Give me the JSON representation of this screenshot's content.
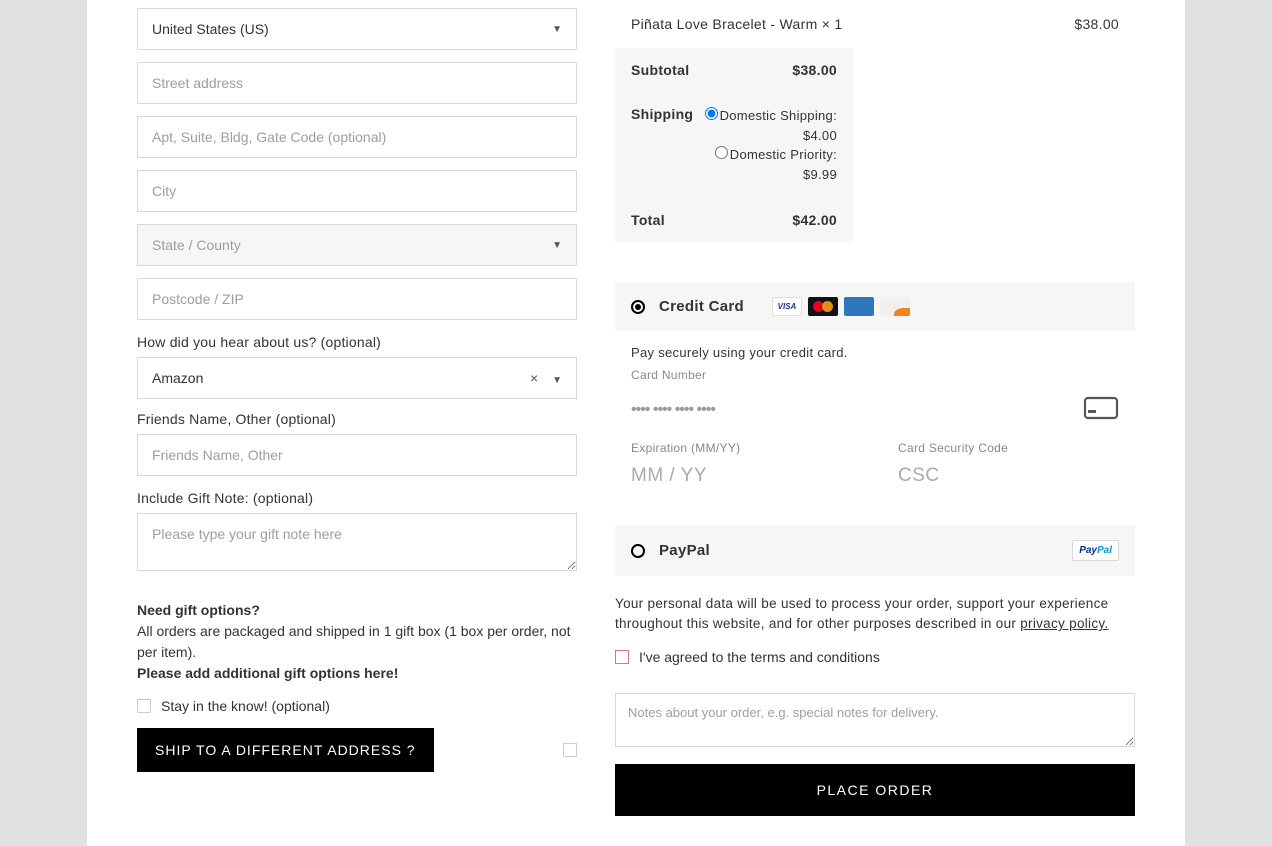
{
  "billing": {
    "country_value": "United States (US)",
    "street_placeholder": "Street address",
    "apt_placeholder": "Apt, Suite, Bldg, Gate Code (optional)",
    "city_placeholder": "City",
    "state_placeholder": "State / County",
    "zip_placeholder": "Postcode / ZIP"
  },
  "referral": {
    "label": "How did you hear about us? (optional)",
    "value": "Amazon"
  },
  "friends": {
    "label": "Friends Name, Other (optional)",
    "placeholder": "Friends Name, Other"
  },
  "gift_note": {
    "label": "Include Gift Note: (optional)",
    "placeholder": "Please type your gift note here"
  },
  "gift_info": {
    "heading": "Need gift options?",
    "line": "All orders are packaged and shipped in 1 gift box (1 box per order, not per item).",
    "cta": "Please add additional gift options here!"
  },
  "newsletter_label": "Stay in the know! (optional)",
  "ship_diff_label": "SHIP TO A DIFFERENT ADDRESS ?",
  "order": {
    "item_name": "Piñata Love Bracelet - Warm ",
    "item_qty": " × 1",
    "item_price": "$38.00",
    "subtotal_label": "Subtotal",
    "subtotal_value": "$38.00",
    "shipping_label": "Shipping",
    "shipping_options": [
      {
        "label": "Domestic Shipping: ",
        "price": "$4.00",
        "selected": true
      },
      {
        "label": "Domestic Priority: ",
        "price": "$9.99",
        "selected": false
      }
    ],
    "total_label": "Total",
    "total_value": "$42.00"
  },
  "payment": {
    "cc_label": "Credit Card",
    "cc_desc": "Pay securely using your credit card.",
    "card_number_label": "Card Number",
    "card_number_placeholder": "•••• •••• •••• ••••",
    "expiry_label": "Expiration (MM/YY)",
    "expiry_placeholder": "MM / YY",
    "csc_label": "Card Security Code",
    "csc_placeholder": "CSC",
    "paypal_label": "PayPal"
  },
  "privacy_text": "Your personal data will be used to process your order, support your experience throughout this website, and for other purposes described in our ",
  "privacy_link": "privacy policy.",
  "terms_label": "I've agreed to the terms and conditions",
  "order_notes_placeholder": "Notes about your order, e.g. special notes for delivery.",
  "place_order_label": "PLACE ORDER"
}
